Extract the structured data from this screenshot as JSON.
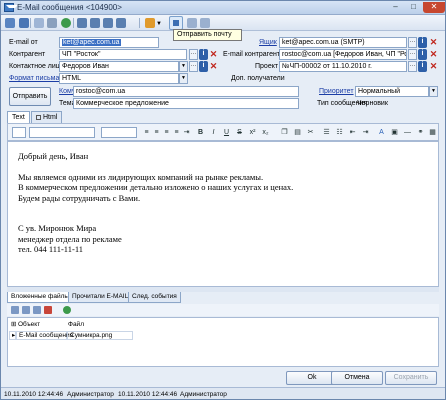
{
  "window": {
    "title": "E-Mail сообщения <104900>",
    "controls": {
      "minimize": "–",
      "maximize": "□",
      "close": "✕"
    }
  },
  "toolbar": {
    "tooltip": "Отправить почту",
    "icons": [
      "save-icon",
      "save-close-icon",
      "copy-icon",
      "attach-icon",
      "refresh-icon",
      "forward-icon",
      "reply-icon",
      "reply-icon",
      "reply-all-icon",
      "status-icon",
      "send-mail-icon",
      "print-icon",
      "close-doc-icon"
    ]
  },
  "form": {
    "email_from": {
      "label": "E-mail от",
      "value": "ket@apec.com.ua"
    },
    "mailbox": {
      "label": "Ящик",
      "value": "ket@apec.com.ua (SMTP)"
    },
    "contractor": {
      "label": "Контрагент",
      "value": "ЧП \"Росток\""
    },
    "contractor_email": {
      "label": "E-mail контрагента",
      "value": "rostoc@com.ua [Федоров Иван, ЧП \"Рос"
    },
    "contact": {
      "label": "Контактное лицо",
      "value": "Федоров Иван"
    },
    "project": {
      "label": "Проект",
      "value": "№ЧП-00002 от 11.10.2010 г."
    },
    "format": {
      "label": "Формат письма",
      "value": "HTML"
    },
    "extra_recipients": {
      "label": "Доп. получатели",
      "value": ""
    },
    "send_button": "Отправить",
    "to": {
      "label": "Кому",
      "value": "rostoc@com.ua"
    },
    "priority": {
      "label": "Приоритет",
      "value": "Нормальный"
    },
    "subject": {
      "label": "Тема",
      "value": "Коммерческое предложение"
    },
    "mail_type": {
      "label": "Тип сообщения",
      "value": "Черновик"
    }
  },
  "editor_tabs": [
    {
      "label": "Text"
    },
    {
      "label": "Html"
    }
  ],
  "editor_toolbar": {
    "buttons": [
      "B",
      "I",
      "U",
      "S",
      "x²",
      "x₂"
    ]
  },
  "body": {
    "greeting": "Добрый день, Иван",
    "line1": "Мы являемся одними из лидирующих компаний на рынке рекламы.",
    "line2": "В коммерческом предложении детально изложено о наших услугах и ценах.",
    "line3": "Будем рады сотрудничать с Вами.",
    "sign1": "С ув. Миронюк Мира",
    "sign2": "менеджер отдела по рекламе",
    "sign3": "тел. 044 111-11-11"
  },
  "bottom_tabs": [
    {
      "label": "Вложенные файлы"
    },
    {
      "label": "Прочитали E-MAIL"
    },
    {
      "label": "След. события"
    }
  ],
  "attachments": {
    "columns": [
      "Объект",
      "Файл"
    ],
    "rows": [
      {
        "object": "E-Mail сообщения",
        "file": "Сумникра.png"
      }
    ]
  },
  "dialog_buttons": {
    "ok": "Ok",
    "cancel": "Отмена",
    "save": "Сохранить"
  },
  "statusbar": {
    "created": "10.11.2010 12:44:46",
    "created_by": "Администратор",
    "modified": "10.11.2010 12:44:46",
    "modified_by": "Администратор"
  }
}
